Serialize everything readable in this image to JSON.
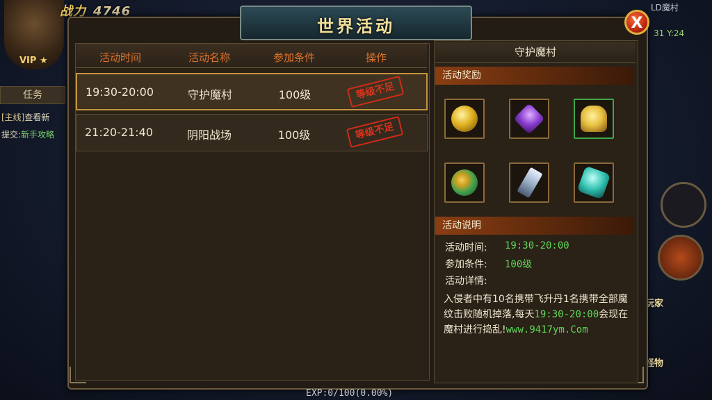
{
  "hud": {
    "power_label": "战力",
    "power_value": "4746",
    "vip_label": "VIP",
    "task_tab": "任务",
    "task_tag": "[主线]",
    "task_text": "查看新",
    "submit_label": "提交:",
    "submit_value": "新手攻略",
    "location_name": "LD魔村",
    "location_coord": "31 Y:24",
    "side_label_1": "玩家",
    "side_label_2": "怪物",
    "exp_text": "EXP:0/100(0.00%)"
  },
  "dialog": {
    "title": "世界活动",
    "close_label": "X"
  },
  "table": {
    "headers": [
      "活动时间",
      "活动名称",
      "参加条件",
      "操作"
    ],
    "rows": [
      {
        "time": "19:30-20:00",
        "name": "守护魔村",
        "condition": "100级",
        "status": "等级不足",
        "selected": true
      },
      {
        "time": "21:20-21:40",
        "name": "阴阳战场",
        "condition": "100级",
        "status": "等级不足",
        "selected": false
      }
    ]
  },
  "detail": {
    "name": "守护魔村",
    "rewards_header": "活动奖励",
    "rewards": [
      {
        "icon": "gold-orb-icon",
        "color": "#e0b020"
      },
      {
        "icon": "purple-crystal-icon",
        "color": "#8a3ed0"
      },
      {
        "icon": "gold-ingot-icon",
        "color": "#e8c040"
      },
      {
        "icon": "jade-orb-icon",
        "color": "#40a050"
      },
      {
        "icon": "ice-shard-icon",
        "color": "#9ab0c8"
      },
      {
        "icon": "teal-crystal-icon",
        "color": "#30c0b0"
      }
    ],
    "desc_header": "活动说明",
    "time_label": "活动时间:",
    "time_value": "19:30-20:00",
    "cond_label": "参加条件:",
    "cond_value": "100级",
    "detail_label": "活动详情:",
    "desc_part1": "入侵者中有10名携带飞升丹1名携带全部魔纹击败随机掉落,每天",
    "desc_time": "19:30-20:00",
    "desc_part2": "会现在魔村进行捣乱!",
    "desc_url": "www.9417ym.Com"
  }
}
